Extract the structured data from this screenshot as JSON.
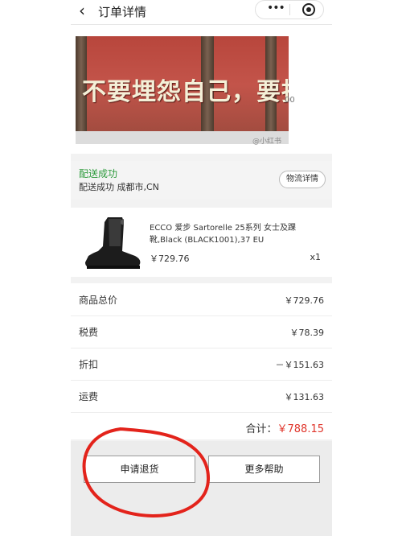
{
  "header": {
    "back_icon": "chevron-left-icon",
    "title": "订单详情",
    "more_icon": "more-dots-icon",
    "more_glyph": "•••",
    "close_icon": "target-circle-icon"
  },
  "address_area": {
    "banner_slogan": "不要埋怨自己，要指责他人",
    "side_number": "00",
    "watermark": "@小红书"
  },
  "delivery": {
    "status": "配送成功",
    "detail": "配送成功 成都市,CN",
    "logistics_button": "物流详情"
  },
  "product": {
    "name": "ECCO 爱步 Sartorelle 25系列 女士及踝靴,Black (BLACK1001),37 EU",
    "price": "￥729.76",
    "quantity": "x1"
  },
  "summary": {
    "rows": [
      {
        "label": "商品总价",
        "value": "￥729.76"
      },
      {
        "label": "税费",
        "value": "￥78.39"
      },
      {
        "label": "折扣",
        "value": "－￥151.63"
      },
      {
        "label": "运费",
        "value": "￥131.63"
      }
    ],
    "total_label": "合计：",
    "total_value": "￥788.15"
  },
  "actions": {
    "return_button": "申请退货",
    "help_button": "更多帮助"
  },
  "colors": {
    "accent_green": "#2e9b3d",
    "total_red": "#e0352b",
    "annotation_red": "#e3231b"
  }
}
